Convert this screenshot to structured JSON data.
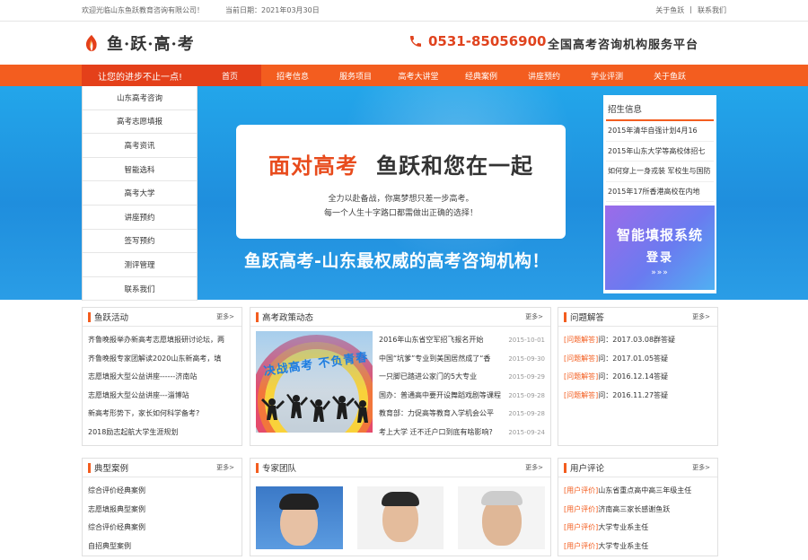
{
  "topbar": {
    "welcome": "欢迎光临山东鱼跃教育咨询有限公司！",
    "date": "当前日期：2021年03月30日",
    "about": "关于鱼跃",
    "contact": "联系我们",
    "sep": "|"
  },
  "header": {
    "logo": "鱼·跃·高·考",
    "phone": "0531-85056900",
    "slogan": "全国高考咨询机构服务平台"
  },
  "nav": {
    "promo": "让您的进步不止一点!",
    "items": [
      "首页",
      "招考信息",
      "服务项目",
      "高考大讲堂",
      "经典案例",
      "讲座预约",
      "学业评测",
      "关于鱼跃"
    ]
  },
  "sidebar": {
    "items": [
      "山东高考咨询",
      "高考志愿填报",
      "高考资讯",
      "智能选科",
      "高考大学",
      "讲座预约",
      "签写预约",
      "测评管理",
      "联系我们"
    ]
  },
  "banner": {
    "title_a": "面对高考",
    "title_b": "鱼跃和您在一起",
    "line1": "全力以赴备战，你离梦想只差一步高考。",
    "line2": "每一个人生十字路口都需做出正确的选择！",
    "big_slogan": "鱼跃高考-山东最权威的高考咨询机构！"
  },
  "recruit": {
    "title": "招生信息",
    "items": [
      "2015年清华自强计划4月16",
      "2015年山东大学等高校体招七",
      "如何穿上一身戎装 军校生与国防",
      "2015年17所香港高校在内地"
    ]
  },
  "system_button": {
    "line1": "智能填报系统",
    "line2": "登录",
    "line3": "»»»"
  },
  "panels": {
    "activities": {
      "title": "鱼跃活动",
      "more": "更多>",
      "items": [
        "齐鲁晚报举办新高考志愿填报研讨论坛，两",
        "齐鲁晚报专家团解读2020山东新高考，填",
        "志愿填报大型公益讲座------济南站",
        "志愿填报大型公益讲座---淄博站",
        "新高考形势下，家长如何科学备考?",
        "2018励志起航大学生涯规划"
      ]
    },
    "policy": {
      "title": "高考政策动态",
      "more": "更多>",
      "image_text": "决战高考  不负青春",
      "items": [
        {
          "text": "2016年山东省空军招飞报名开始",
          "date": "2015-10-01"
        },
        {
          "text": "中国“坑爹”专业到美国居然成了“香",
          "date": "2015-09-30"
        },
        {
          "text": "一只脚已踏进公家门的5大专业",
          "date": "2015-09-29"
        },
        {
          "text": "国办：普通高中要开设舞蹈戏剧等课程",
          "date": "2015-09-28"
        },
        {
          "text": "教育部：力促高等教育入学机会公平",
          "date": "2015-09-28"
        },
        {
          "text": "考上大学 迁不迁户口到底有啥影响?",
          "date": "2015-09-24"
        }
      ]
    },
    "qa": {
      "title": "问题解答",
      "more": "更多>",
      "items": [
        {
          "tag": "[问题解答]",
          "text": "问：2017.03.08群答疑"
        },
        {
          "tag": "[问题解答]",
          "text": "问：2017.01.05答疑"
        },
        {
          "tag": "[问题解答]",
          "text": "问：2016.12.14答疑"
        },
        {
          "tag": "[问题解答]",
          "text": "问：2016.11.27答疑"
        }
      ]
    },
    "cases": {
      "title": "典型案例",
      "more": "更多>",
      "items": [
        "综合评价经典案例",
        "志愿填报典型案例",
        "综合评价经典案例",
        "自招典型案例"
      ]
    },
    "experts": {
      "title": "专家团队",
      "more": "更多>"
    },
    "reviews": {
      "title": "用户评论",
      "more": "更多>",
      "items": [
        {
          "tag": "[用户评价]",
          "text": "山东省重点高中高三年级主任"
        },
        {
          "tag": "[用户评价]",
          "text": "济南高三家长感谢鱼跃"
        },
        {
          "tag": "[用户评价]",
          "text": "大学专业系主任"
        },
        {
          "tag": "[用户评价]",
          "text": "大学专业系主任"
        }
      ]
    }
  },
  "colors": {
    "accent": "#f35d1f",
    "accent_dark": "#e4401a",
    "banner": "#23a6ea"
  }
}
